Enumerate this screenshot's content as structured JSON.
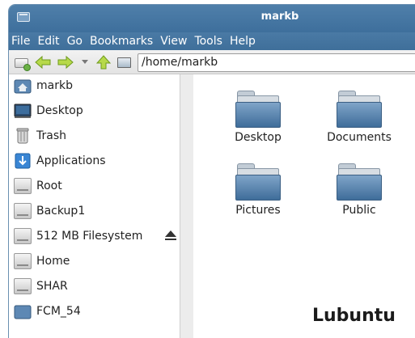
{
  "window": {
    "title": "markb"
  },
  "menu": [
    "File",
    "Edit",
    "Go",
    "Bookmarks",
    "View",
    "Tools",
    "Help"
  ],
  "toolbar": {
    "icons": [
      "new-window-icon",
      "back-arrow-icon",
      "forward-arrow-icon",
      "history-dropdown-icon",
      "parent-folder-icon",
      "location-toggle-icon"
    ],
    "location": "/home/markb"
  },
  "sidebar": {
    "items": [
      {
        "label": "markb",
        "icon": "home-folder-icon"
      },
      {
        "label": "Desktop",
        "icon": "desktop-icon"
      },
      {
        "label": "Trash",
        "icon": "trash-icon"
      },
      {
        "label": "Applications",
        "icon": "applications-icon"
      },
      {
        "label": "Root",
        "icon": "drive-icon"
      },
      {
        "label": "Backup1",
        "icon": "drive-icon"
      },
      {
        "label": "512 MB Filesystem",
        "icon": "drive-icon",
        "eject": true
      },
      {
        "label": "Home",
        "icon": "drive-icon"
      },
      {
        "label": "SHAR",
        "icon": "drive-icon"
      },
      {
        "label": "FCM_54",
        "icon": "folder-icon"
      }
    ]
  },
  "files": [
    {
      "name": "Desktop"
    },
    {
      "name": "Documents"
    },
    {
      "name": "Pictures"
    },
    {
      "name": "Public"
    }
  ],
  "watermark": "Lubuntu"
}
